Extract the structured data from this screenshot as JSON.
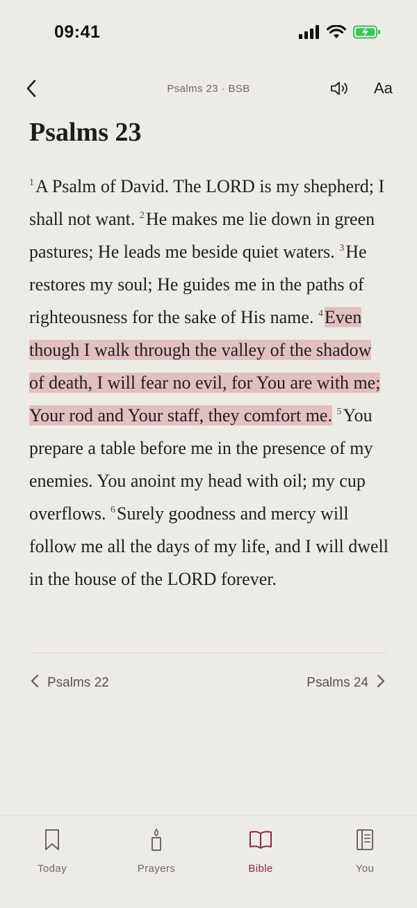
{
  "status_bar": {
    "time": "09:41"
  },
  "nav": {
    "title": "Psalms 23 · BSB",
    "font_button": "Aa"
  },
  "chapter": {
    "title": "Psalms 23",
    "verses": [
      {
        "num": "1",
        "text": "A Psalm of David. The LORD is my shepherd; I shall not want."
      },
      {
        "num": "2",
        "text": "He makes me lie down in green pastures; He leads me beside quiet waters."
      },
      {
        "num": "3",
        "text": "He restores my soul; He guides me in the paths of righteousness for the sake of His name."
      },
      {
        "num": "4",
        "text": "Even though I walk through the valley of the shadow of death, I will fear no evil, for You are with me; Your rod and Your staff, they comfort me."
      },
      {
        "num": "5",
        "text": "You prepare a table before me in the presence of my enemies. You anoint my head with oil; my cup overflows."
      },
      {
        "num": "6",
        "text": "Surely goodness and mercy will follow me all the days of my life, and I will dwell in the house of the LORD forever."
      }
    ],
    "highlighted_verse": "4",
    "highlight_color": "#e2bfc3"
  },
  "chapter_nav": {
    "prev_label": "Psalms 22",
    "next_label": "Psalms 24"
  },
  "tabs": [
    {
      "label": "Today",
      "icon": "bookmark-icon",
      "active": false
    },
    {
      "label": "Prayers",
      "icon": "candle-icon",
      "active": false
    },
    {
      "label": "Bible",
      "icon": "open-book-icon",
      "active": true
    },
    {
      "label": "You",
      "icon": "journal-icon",
      "active": false
    }
  ],
  "colors": {
    "background": "#edebe5",
    "accent": "#8b2b3a",
    "battery": "#34c759"
  }
}
